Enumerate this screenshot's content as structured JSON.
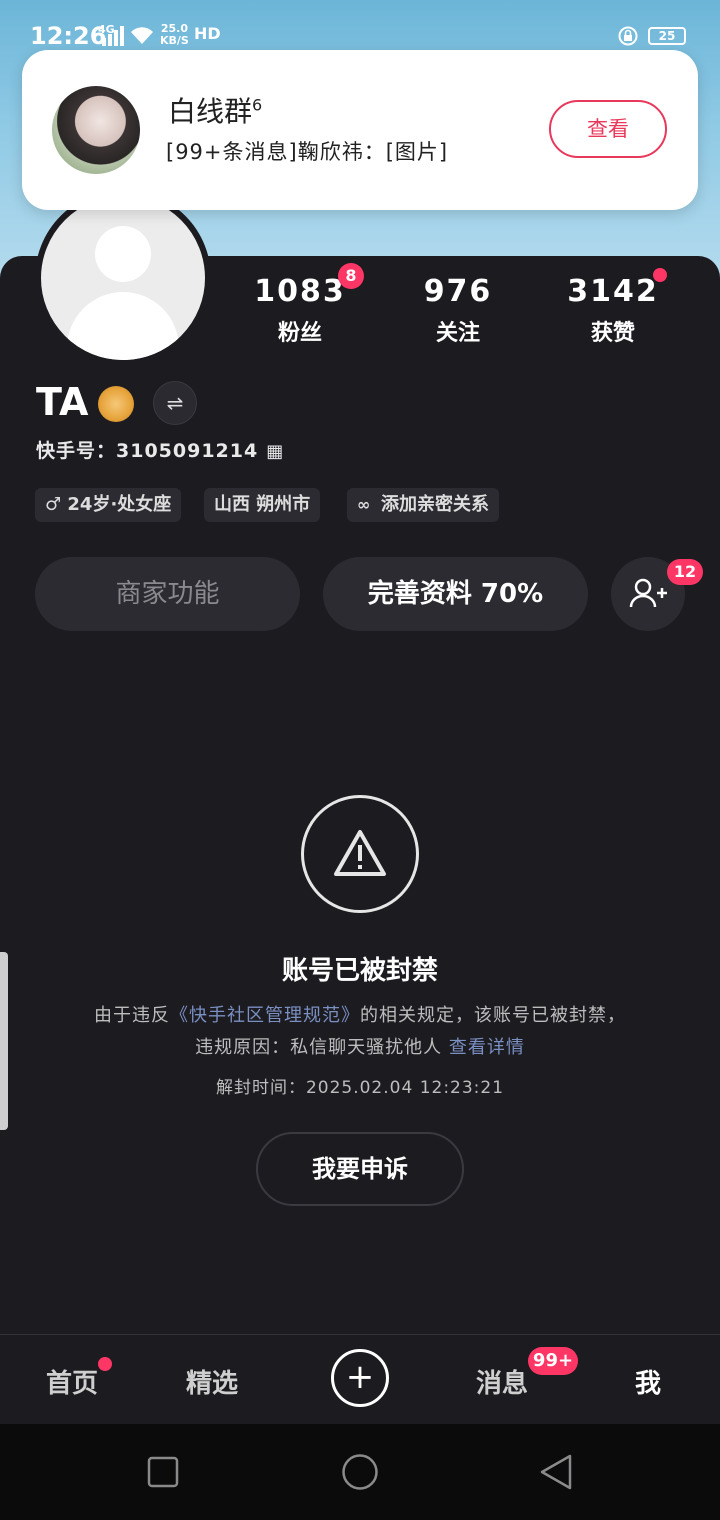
{
  "status_bar": {
    "time": "12:26",
    "network": "4G",
    "speed_value": "25.0",
    "speed_unit": "KB/S",
    "hd": "HD",
    "battery": "25"
  },
  "notification": {
    "title": "白线群",
    "title_sup": "6",
    "message": "[99+条消息]鞠欣祎：[图片]",
    "button": "查看"
  },
  "profile": {
    "name": "TA",
    "kuaishou_id": "快手号：3105091214",
    "stats": [
      {
        "value": "1083",
        "label": "粉丝",
        "badge": "8"
      },
      {
        "value": "976",
        "label": "关注"
      },
      {
        "value": "3142",
        "label": "获赞"
      }
    ],
    "tags": [
      "♂ 24岁·处女座",
      "山西 朔州市",
      "添加亲密关系"
    ],
    "merchant_button": "商家功能",
    "complete_button": "完善资料 70%",
    "add_friend_badge": "12"
  },
  "ban": {
    "title": "账号已被封禁",
    "line1_prefix": "由于违反",
    "line1_link": "《快手社区管理规范》",
    "line1_suffix": "的相关规定，该账号已被封禁，",
    "line2_prefix": "违规原因：私信聊天骚扰他人 ",
    "line2_link": "查看详情",
    "unban_time": "解封时间：2025.02.04 12:23:21",
    "appeal_button": "我要申诉"
  },
  "tabbar": {
    "home": "首页",
    "featured": "精选",
    "plus": "+",
    "messages": "消息",
    "messages_badge": "99+",
    "me": "我"
  },
  "colors": {
    "accent": "#fe3666",
    "background": "#1c1b20",
    "link": "#7a8fc2"
  }
}
